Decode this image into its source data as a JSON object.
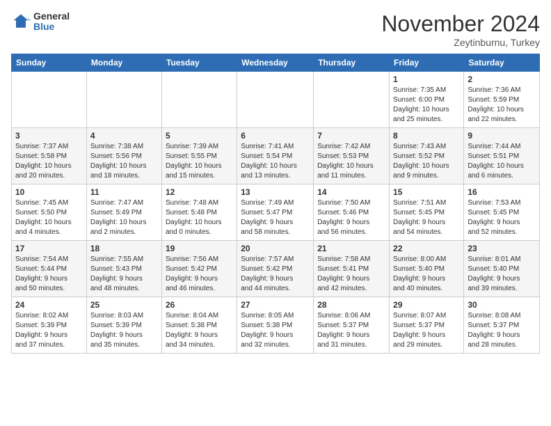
{
  "header": {
    "logo_general": "General",
    "logo_blue": "Blue",
    "month_title": "November 2024",
    "location": "Zeytinburnu, Turkey"
  },
  "weekdays": [
    "Sunday",
    "Monday",
    "Tuesday",
    "Wednesday",
    "Thursday",
    "Friday",
    "Saturday"
  ],
  "weeks": [
    [
      {
        "day": "",
        "info": ""
      },
      {
        "day": "",
        "info": ""
      },
      {
        "day": "",
        "info": ""
      },
      {
        "day": "",
        "info": ""
      },
      {
        "day": "",
        "info": ""
      },
      {
        "day": "1",
        "info": "Sunrise: 7:35 AM\nSunset: 6:00 PM\nDaylight: 10 hours\nand 25 minutes."
      },
      {
        "day": "2",
        "info": "Sunrise: 7:36 AM\nSunset: 5:59 PM\nDaylight: 10 hours\nand 22 minutes."
      }
    ],
    [
      {
        "day": "3",
        "info": "Sunrise: 7:37 AM\nSunset: 5:58 PM\nDaylight: 10 hours\nand 20 minutes."
      },
      {
        "day": "4",
        "info": "Sunrise: 7:38 AM\nSunset: 5:56 PM\nDaylight: 10 hours\nand 18 minutes."
      },
      {
        "day": "5",
        "info": "Sunrise: 7:39 AM\nSunset: 5:55 PM\nDaylight: 10 hours\nand 15 minutes."
      },
      {
        "day": "6",
        "info": "Sunrise: 7:41 AM\nSunset: 5:54 PM\nDaylight: 10 hours\nand 13 minutes."
      },
      {
        "day": "7",
        "info": "Sunrise: 7:42 AM\nSunset: 5:53 PM\nDaylight: 10 hours\nand 11 minutes."
      },
      {
        "day": "8",
        "info": "Sunrise: 7:43 AM\nSunset: 5:52 PM\nDaylight: 10 hours\nand 9 minutes."
      },
      {
        "day": "9",
        "info": "Sunrise: 7:44 AM\nSunset: 5:51 PM\nDaylight: 10 hours\nand 6 minutes."
      }
    ],
    [
      {
        "day": "10",
        "info": "Sunrise: 7:45 AM\nSunset: 5:50 PM\nDaylight: 10 hours\nand 4 minutes."
      },
      {
        "day": "11",
        "info": "Sunrise: 7:47 AM\nSunset: 5:49 PM\nDaylight: 10 hours\nand 2 minutes."
      },
      {
        "day": "12",
        "info": "Sunrise: 7:48 AM\nSunset: 5:48 PM\nDaylight: 10 hours\nand 0 minutes."
      },
      {
        "day": "13",
        "info": "Sunrise: 7:49 AM\nSunset: 5:47 PM\nDaylight: 9 hours\nand 58 minutes."
      },
      {
        "day": "14",
        "info": "Sunrise: 7:50 AM\nSunset: 5:46 PM\nDaylight: 9 hours\nand 56 minutes."
      },
      {
        "day": "15",
        "info": "Sunrise: 7:51 AM\nSunset: 5:45 PM\nDaylight: 9 hours\nand 54 minutes."
      },
      {
        "day": "16",
        "info": "Sunrise: 7:53 AM\nSunset: 5:45 PM\nDaylight: 9 hours\nand 52 minutes."
      }
    ],
    [
      {
        "day": "17",
        "info": "Sunrise: 7:54 AM\nSunset: 5:44 PM\nDaylight: 9 hours\nand 50 minutes."
      },
      {
        "day": "18",
        "info": "Sunrise: 7:55 AM\nSunset: 5:43 PM\nDaylight: 9 hours\nand 48 minutes."
      },
      {
        "day": "19",
        "info": "Sunrise: 7:56 AM\nSunset: 5:42 PM\nDaylight: 9 hours\nand 46 minutes."
      },
      {
        "day": "20",
        "info": "Sunrise: 7:57 AM\nSunset: 5:42 PM\nDaylight: 9 hours\nand 44 minutes."
      },
      {
        "day": "21",
        "info": "Sunrise: 7:58 AM\nSunset: 5:41 PM\nDaylight: 9 hours\nand 42 minutes."
      },
      {
        "day": "22",
        "info": "Sunrise: 8:00 AM\nSunset: 5:40 PM\nDaylight: 9 hours\nand 40 minutes."
      },
      {
        "day": "23",
        "info": "Sunrise: 8:01 AM\nSunset: 5:40 PM\nDaylight: 9 hours\nand 39 minutes."
      }
    ],
    [
      {
        "day": "24",
        "info": "Sunrise: 8:02 AM\nSunset: 5:39 PM\nDaylight: 9 hours\nand 37 minutes."
      },
      {
        "day": "25",
        "info": "Sunrise: 8:03 AM\nSunset: 5:39 PM\nDaylight: 9 hours\nand 35 minutes."
      },
      {
        "day": "26",
        "info": "Sunrise: 8:04 AM\nSunset: 5:38 PM\nDaylight: 9 hours\nand 34 minutes."
      },
      {
        "day": "27",
        "info": "Sunrise: 8:05 AM\nSunset: 5:38 PM\nDaylight: 9 hours\nand 32 minutes."
      },
      {
        "day": "28",
        "info": "Sunrise: 8:06 AM\nSunset: 5:37 PM\nDaylight: 9 hours\nand 31 minutes."
      },
      {
        "day": "29",
        "info": "Sunrise: 8:07 AM\nSunset: 5:37 PM\nDaylight: 9 hours\nand 29 minutes."
      },
      {
        "day": "30",
        "info": "Sunrise: 8:08 AM\nSunset: 5:37 PM\nDaylight: 9 hours\nand 28 minutes."
      }
    ]
  ]
}
